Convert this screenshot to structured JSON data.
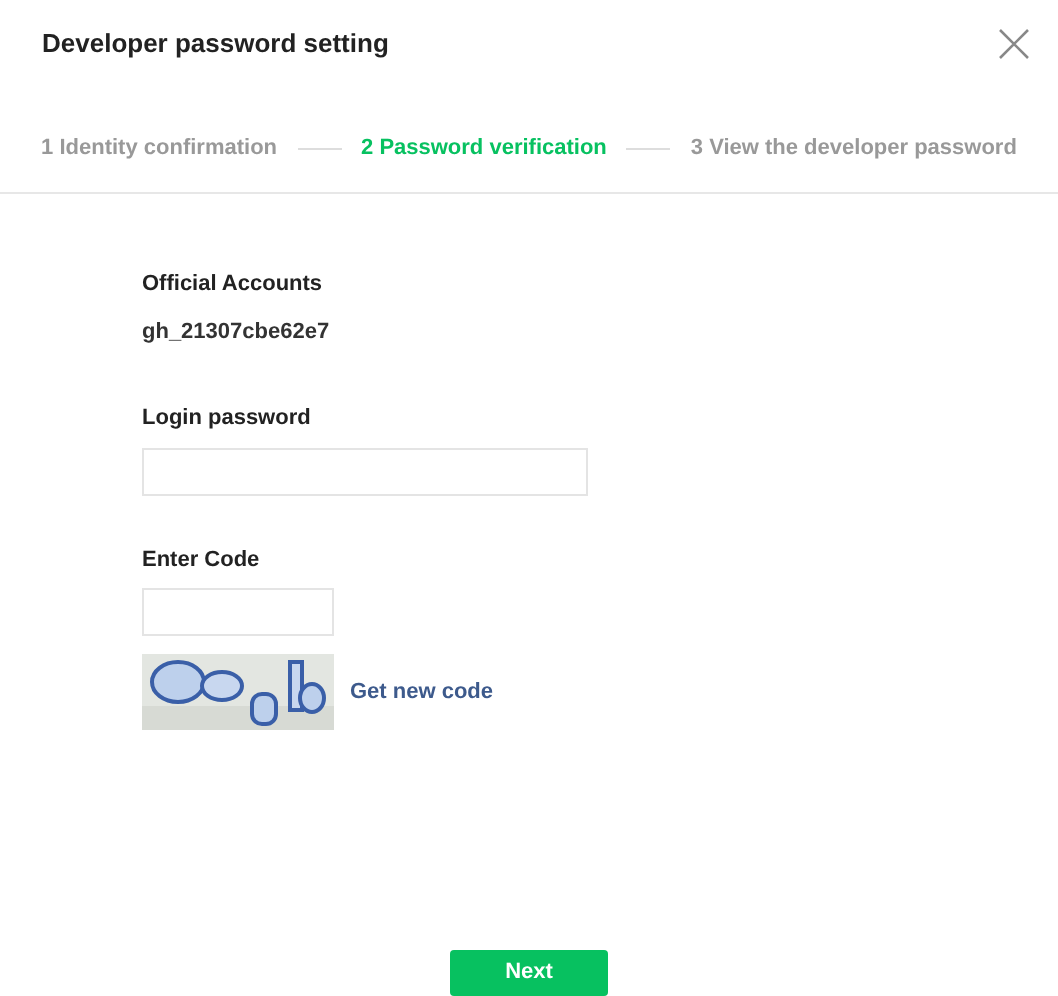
{
  "dialog": {
    "title": "Developer password setting"
  },
  "steps": [
    {
      "label": "1 Identity confirmation",
      "selected": false
    },
    {
      "label": "2 Password verification",
      "selected": true
    },
    {
      "label": "3 View the developer password",
      "selected": false
    }
  ],
  "form": {
    "account_label": "Official Accounts",
    "account_value": "gh_21307cbe62e7",
    "password_label": "Login password",
    "code_label": "Enter Code",
    "new_code_link": "Get new code"
  },
  "buttons": [
    "Next"
  ]
}
